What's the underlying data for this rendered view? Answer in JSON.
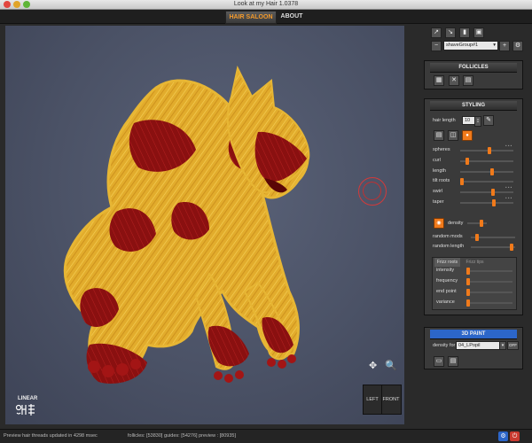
{
  "window": {
    "title": "Look at my Hair 1.0378"
  },
  "tabs": [
    {
      "label": "HAIR SALOON"
    },
    {
      "label": "ABOUT"
    }
  ],
  "viewport": {
    "logo_text": "LINEAR",
    "view_buttons": {
      "left": "LEFT",
      "front": "FRONT"
    }
  },
  "group": {
    "name": "shaveGroup#1"
  },
  "follicles": {
    "title": "FOLLICLES"
  },
  "styling": {
    "title": "STYLING",
    "hair_length_label": "hair length",
    "hair_length_value": "10",
    "params": [
      {
        "label": "spheres",
        "value": 0.55
      },
      {
        "label": "curl",
        "value": 0.1
      },
      {
        "label": "length",
        "value": 0.6
      },
      {
        "label": "tilt roots",
        "value": 0.0
      },
      {
        "label": "swirl",
        "value": 0.62
      },
      {
        "label": "taper",
        "value": 0.65
      }
    ],
    "density_label": "density",
    "random_mods_label": "random mods",
    "random_mods_value": 0.1,
    "random_length_label": "random length",
    "random_length_value": 0.95,
    "frizz_tabs": [
      "Frizz roots",
      "Frizz tips"
    ],
    "frizz_params": [
      {
        "label": "intensity",
        "value": 0.0
      },
      {
        "label": "frequency",
        "value": 0.0
      },
      {
        "label": "end point",
        "value": 0.0
      },
      {
        "label": "variance",
        "value": 0.0
      }
    ]
  },
  "paint": {
    "title": "3D PAINT",
    "density_for_label": "density for",
    "density_for_value": "04_LPopil",
    "off_label": "OFF"
  },
  "status": {
    "message": "Preview hair threads updated in 4298 msec",
    "counts": "follicles: [53830]  guides: [54276]  preview : [80935]"
  },
  "colors": {
    "accent": "#f07a1b",
    "paint_header": "#2c66c9",
    "fur_yellow": "#e7b634",
    "fur_red": "#8d1212"
  }
}
